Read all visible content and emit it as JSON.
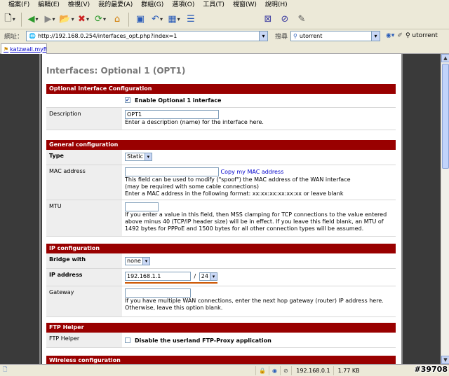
{
  "menu": [
    "檔案(F)",
    "編輯(E)",
    "檢視(V)",
    "我的最愛(A)",
    "群組(G)",
    "選項(O)",
    "工具(T)",
    "視窗(W)",
    "說明(H)"
  ],
  "address": {
    "label": "網址：",
    "url": "http://192.168.0.254/interfaces_opt.php?index=1",
    "search_label": "搜尋",
    "search_query": "utorrent",
    "search_button": "utorrent"
  },
  "tab": {
    "label": "katzwall.myft..."
  },
  "page": {
    "title": "Interfaces: Optional 1 (OPT1)",
    "sections": {
      "optional": "Optional Interface Configuration",
      "general": "General configuration",
      "ip": "IP configuration",
      "ftp": "FTP Helper",
      "wireless": "Wireless configuration"
    },
    "enable_label": "Enable Optional 1 interface",
    "description": {
      "label": "Description",
      "value": "OPT1",
      "hint": "Enter a description (name) for the interface here."
    },
    "type": {
      "label": "Type",
      "value": "Static"
    },
    "mac": {
      "label": "MAC address",
      "copy_link": "Copy my MAC address",
      "hint1": "This field can be used to modify (\"spoof\") the MAC address of the WAN interface",
      "hint2": "(may be required with some cable connections)",
      "hint3": "Enter a MAC address in the following format: xx:xx:xx:xx:xx:xx or leave blank"
    },
    "mtu": {
      "label": "MTU",
      "hint": "If you enter a value in this field, then MSS clamping for TCP connections to the value entered above minus 40 (TCP/IP header size) will be in effect. If you leave this field blank, an MTU of 1492 bytes for PPPoE and 1500 bytes for all other connection types will be assumed."
    },
    "bridge": {
      "label": "Bridge with",
      "value": "none"
    },
    "ip": {
      "label": "IP address",
      "value": "192.168.1.1",
      "slash": "/",
      "mask": "24"
    },
    "gateway": {
      "label": "Gateway",
      "hint": "If you have multiple WAN connections, enter the next hop gateway (router) IP address here. Otherwise, leave this option blank."
    },
    "ftp_helper": {
      "label": "FTP Helper",
      "checkbox_label": "Disable the userland FTP-Proxy application"
    }
  },
  "status": {
    "ip": "192.168.0.1",
    "size": "1.77 KB",
    "badge": "#39708"
  }
}
